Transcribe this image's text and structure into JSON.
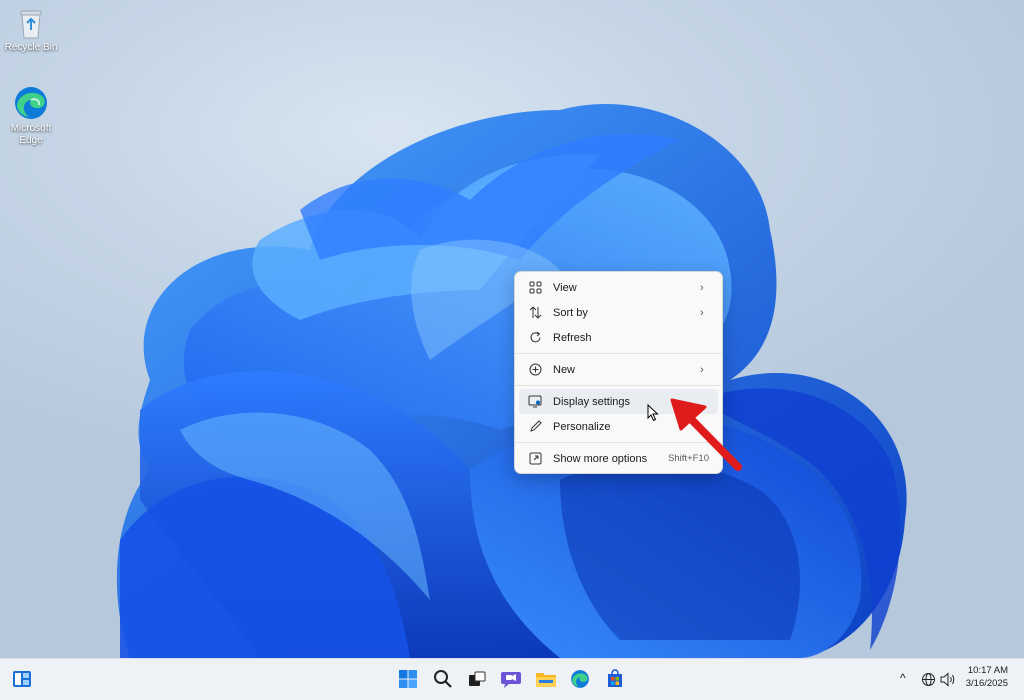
{
  "desktop_icons": [
    {
      "label": "Recycle Bin",
      "icon": "recycle-bin-icon"
    },
    {
      "label": "Microsoft Edge",
      "icon": "edge-icon"
    }
  ],
  "context_menu": {
    "items": [
      {
        "label": "View",
        "icon": "grid-icon",
        "submenu": true
      },
      {
        "label": "Sort by",
        "icon": "sort-icon",
        "submenu": true
      },
      {
        "label": "Refresh",
        "icon": "refresh-icon",
        "submenu": false
      },
      {
        "label": "New",
        "icon": "plus-circle-icon",
        "submenu": true
      },
      {
        "label": "Display settings",
        "icon": "display-icon",
        "submenu": false,
        "highlighted": true
      },
      {
        "label": "Personalize",
        "icon": "pen-icon",
        "submenu": false
      },
      {
        "label": "Show more options",
        "icon": "expand-icon",
        "shortcut": "Shift+F10"
      }
    ]
  },
  "taskbar": {
    "apps": [
      "widgets-icon",
      "start-icon",
      "search-icon",
      "task-view-icon",
      "chat-icon",
      "file-explorer-icon",
      "edge-icon",
      "store-icon"
    ],
    "tray": {
      "chevron": "^",
      "icons": [
        "network-icon",
        "volume-icon"
      ]
    },
    "clock": {
      "time": "10:17 AM",
      "date": "3/16/2025"
    }
  },
  "colors": {
    "accent": "#0067c0",
    "wallpaper_blue": "#1a5ee0",
    "annotation_arrow": "#e01b1b"
  }
}
